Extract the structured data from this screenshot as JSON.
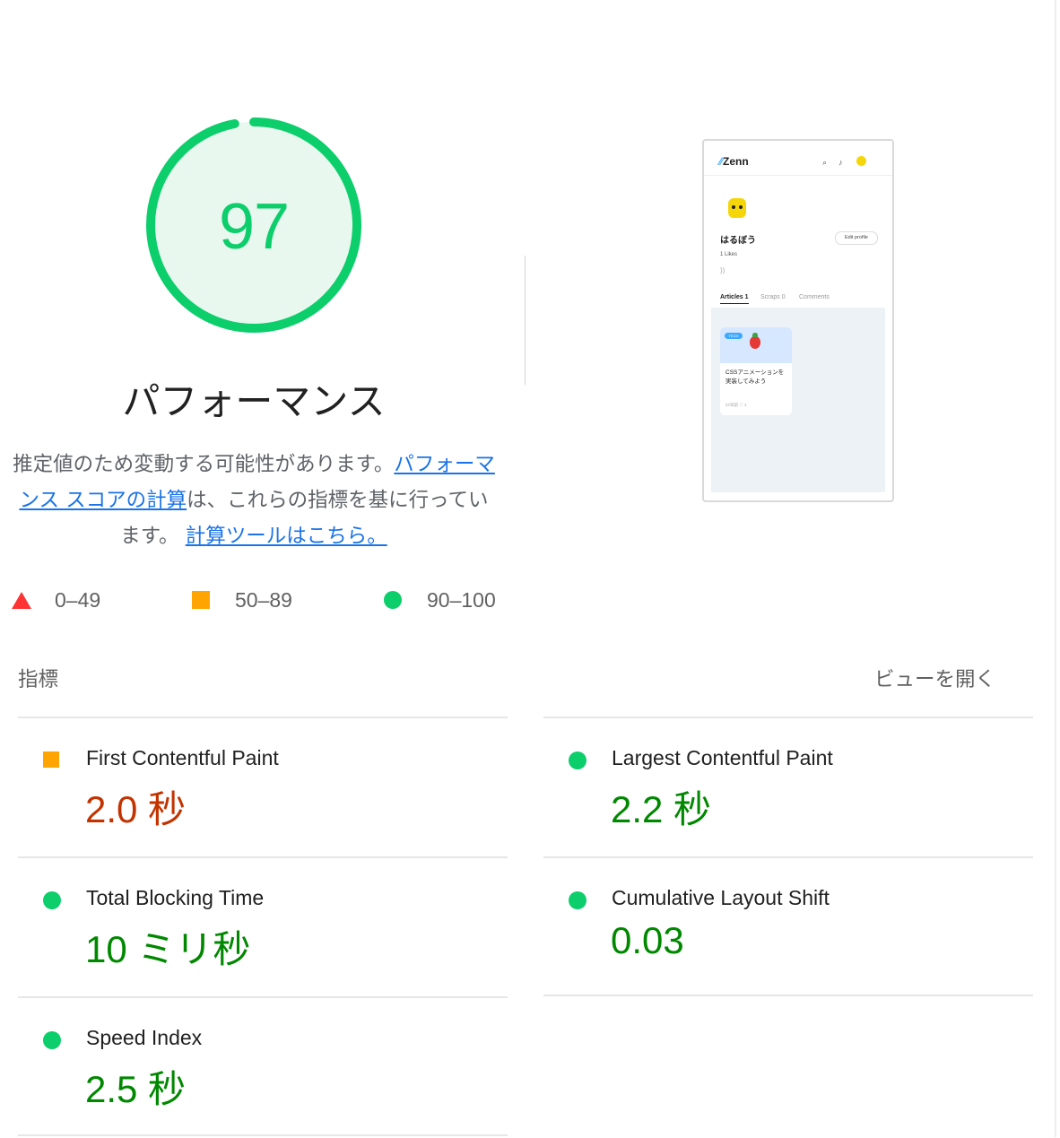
{
  "performance": {
    "score": "97",
    "title": "パフォーマンス",
    "description_prefix": "推定値のため変動する可能性があります。",
    "link_score": "パフォーマンス スコアの計算",
    "description_middle": "は、これらの指標を基に行っています。",
    "link_calculator": "計算ツールはこちら。"
  },
  "legend": [
    {
      "label": "0–49",
      "shape": "triangle",
      "color": "#ff3333"
    },
    {
      "label": "50–89",
      "shape": "square",
      "color": "#ffa400"
    },
    {
      "label": "90–100",
      "shape": "circle",
      "color": "#0cce6b"
    }
  ],
  "thumbnail": {
    "logo": "Zenn",
    "user_name": "はるぼう",
    "edit_button": "Edit profile",
    "likes": "1 Likes",
    "tabs": [
      "Articles 1",
      "Scraps 0",
      "Comments"
    ],
    "card_badge": "TECH",
    "card_title": "CSSアニメーションを実装してみよう",
    "card_meta": "27日前 ♡ 1"
  },
  "metrics_section": {
    "label": "指標",
    "toggle": "ビューを開く"
  },
  "metrics": [
    {
      "title": "First Contentful Paint",
      "value": "2.0 秒",
      "status": "average",
      "icon": "square"
    },
    {
      "title": "Largest Contentful Paint",
      "value": "2.2 秒",
      "status": "pass",
      "icon": "circle"
    },
    {
      "title": "Total Blocking Time",
      "value": "10 ミリ秒",
      "status": "pass",
      "icon": "circle"
    },
    {
      "title": "Cumulative Layout Shift",
      "value": "0.03",
      "status": "pass",
      "icon": "circle"
    },
    {
      "title": "Speed Index",
      "value": "2.5 秒",
      "status": "pass",
      "icon": "circle"
    }
  ],
  "colors": {
    "pass": "#0cce6b",
    "pass_text": "#008800",
    "average": "#ffa400",
    "average_text": "#c33300",
    "fail": "#ff3333",
    "link": "#1a73e8"
  }
}
